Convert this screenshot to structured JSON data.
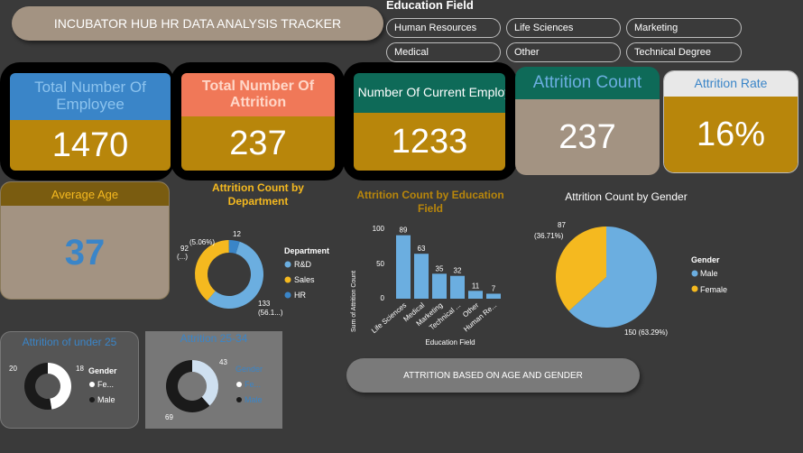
{
  "header": {
    "title": "INCUBATOR HUB HR DATA ANALYSIS TRACKER"
  },
  "education_slicer": {
    "title": "Education Field",
    "options": [
      "Human Resources",
      "Life Sciences",
      "Marketing",
      "Medical",
      "Other",
      "Technical Degree"
    ]
  },
  "kpis": {
    "total_employees": {
      "label": "Total Number Of Employee",
      "value": "1470"
    },
    "total_attrition": {
      "label": "Total Number Of Attrition",
      "value": "237"
    },
    "current_employees": {
      "label": "Total Number Of Current Employees",
      "value": "1233"
    },
    "attrition_count": {
      "label": "Attrition Count",
      "value": "237"
    },
    "attrition_rate": {
      "label": "Attrition Rate",
      "value": "16%"
    },
    "average_age": {
      "label": "Average Age",
      "value": "37"
    }
  },
  "colors": {
    "blue": "#6baee0",
    "gold": "#b8860b",
    "yellow": "#f5b91f",
    "black": "#1a1a1a",
    "white": "#ffffff"
  },
  "dept_chart": {
    "title": "Attrition Count by Department",
    "legend_title": "Department",
    "labels": {
      "top": "12",
      "top_pct": "(5.06%)",
      "left": "92",
      "left_pct": "(...)",
      "bottom": "133",
      "bottom_pct": "(56.1...)"
    },
    "chart_data": {
      "type": "pie",
      "categories": [
        "R&D",
        "Sales",
        "HR"
      ],
      "values": [
        133,
        92,
        12
      ]
    }
  },
  "edu_chart": {
    "title": "Attrition Count by Education Field",
    "ylabel": "Sum of Attrition Count",
    "xlabel": "Education Field",
    "yticks": [
      "100",
      "50",
      "0"
    ],
    "chart_data": {
      "type": "bar",
      "categories": [
        "Life Sciences",
        "Medical",
        "Marketing",
        "Technical ...",
        "Other",
        "Human Re..."
      ],
      "values": [
        89,
        63,
        35,
        32,
        11,
        7
      ],
      "ylim": [
        0,
        100
      ]
    }
  },
  "gender_chart": {
    "title": "Attrition Count by Gender",
    "legend_title": "Gender",
    "labels": {
      "female": "87",
      "female_pct": "(36.71%)",
      "male": "150 (63.29%)"
    },
    "chart_data": {
      "type": "pie",
      "categories": [
        "Male",
        "Female"
      ],
      "values": [
        150,
        87
      ]
    }
  },
  "under25": {
    "title": "Attrition of under 25",
    "legend_title": "Gender",
    "labels": {
      "left": "20",
      "right": "18"
    },
    "legend": [
      "Fe...",
      "Male"
    ],
    "chart_data": {
      "type": "pie",
      "categories": [
        "Female",
        "Male"
      ],
      "values": [
        18,
        20
      ]
    }
  },
  "age25_34": {
    "title": "Attrition 25-34",
    "legend_title": "Gender",
    "labels": {
      "top": "43",
      "bottom": "69"
    },
    "legend": [
      "Fe...",
      "Male"
    ],
    "chart_data": {
      "type": "pie",
      "categories": [
        "Female",
        "Male"
      ],
      "values": [
        43,
        69
      ]
    }
  },
  "button": {
    "label": "ATTRITION BASED ON AGE AND GENDER"
  }
}
